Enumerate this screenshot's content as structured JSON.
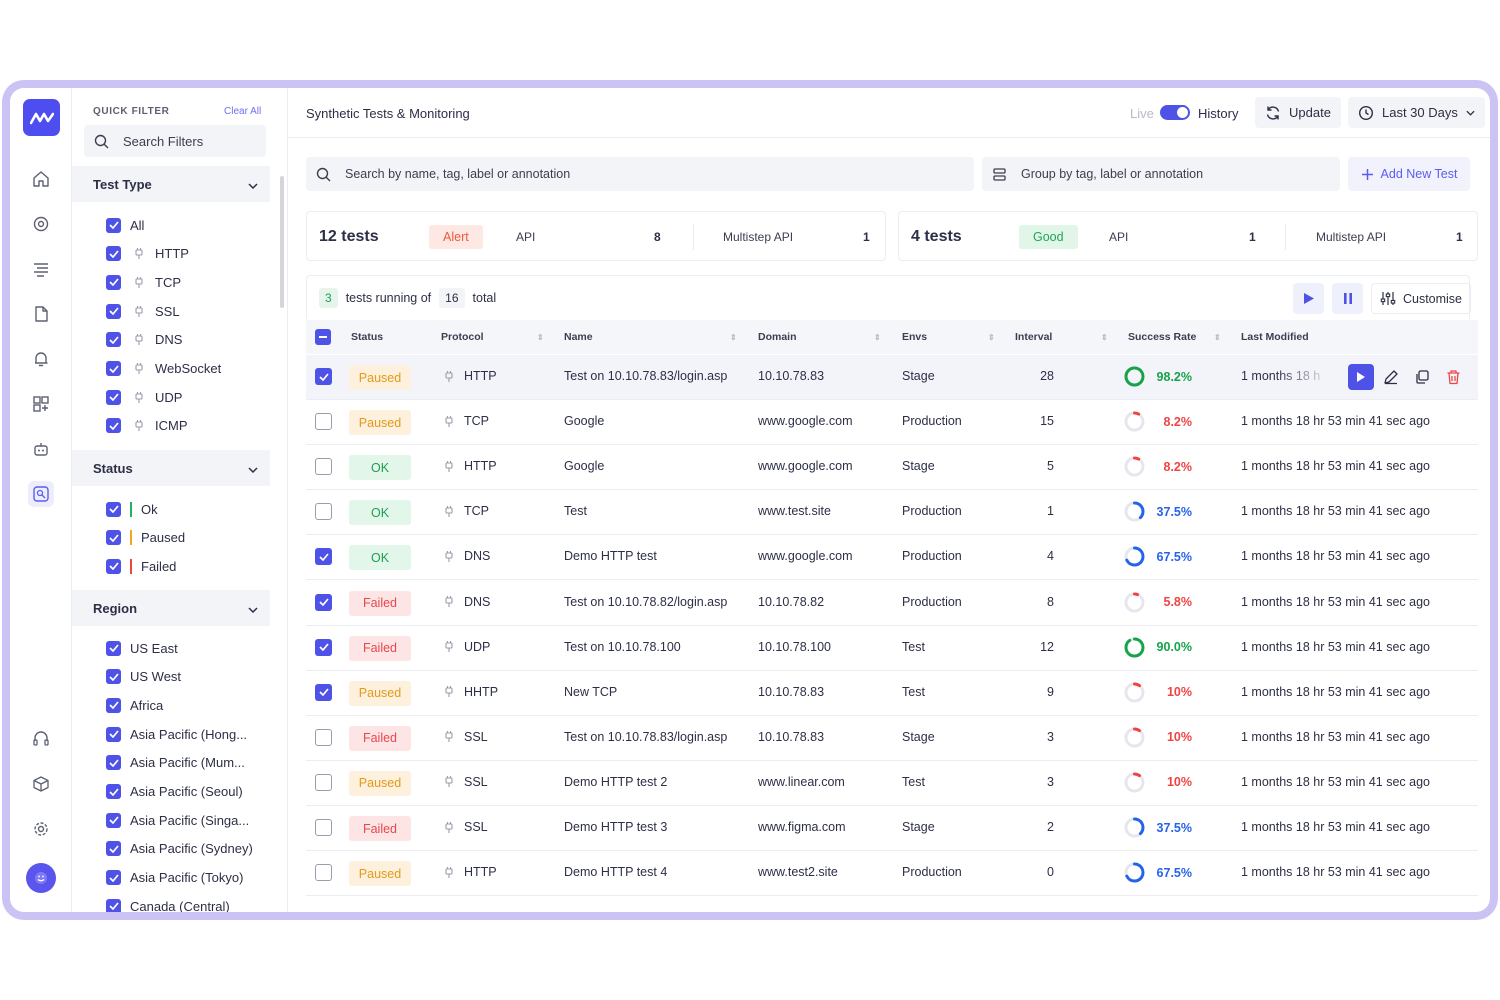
{
  "quick_filter": {
    "title": "QUICK FILTER",
    "clear_all": "Clear All",
    "search_placeholder": "Search Filters",
    "sections": {
      "test_type": {
        "title": "Test Type",
        "items": [
          {
            "label": "All",
            "icon": null
          },
          {
            "label": "HTTP",
            "icon": "plug-icon"
          },
          {
            "label": "TCP",
            "icon": "plug-icon"
          },
          {
            "label": "SSL",
            "icon": "plug-icon"
          },
          {
            "label": "DNS",
            "icon": "plug-icon"
          },
          {
            "label": "WebSocket",
            "icon": "plug-icon"
          },
          {
            "label": "UDP",
            "icon": "plug-icon"
          },
          {
            "label": "ICMP",
            "icon": "plug-icon"
          }
        ]
      },
      "status": {
        "title": "Status",
        "items": [
          {
            "label": "Ok",
            "color": "#22b35e"
          },
          {
            "label": "Paused",
            "color": "#f5a524"
          },
          {
            "label": "Failed",
            "color": "#ef4444"
          }
        ]
      },
      "region": {
        "title": "Region",
        "items": [
          "US East",
          "US West",
          "Africa",
          "Asia Pacific (Hong...",
          "Asia Pacific (Mum...",
          "Asia Pacific (Seoul)",
          "Asia Pacific (Singa...",
          "Asia Pacific (Sydney)",
          "Asia Pacific (Tokyo)",
          "Canada (Central)"
        ]
      }
    }
  },
  "topbar": {
    "title": "Synthetic Tests & Monitoring",
    "live_label": "Live",
    "history_label": "History",
    "update_label": "Update",
    "range_label": "Last 30 Days"
  },
  "toolbar": {
    "search_placeholder": "Search by name, tag, label or annotation",
    "group_placeholder": "Group by tag, label or annotation",
    "add_label": "Add New Test"
  },
  "summary": [
    {
      "count": "12 tests",
      "badge": "Alert",
      "api_label": "API",
      "api_count": "8",
      "multistep_label": "Multistep API",
      "multistep_count": "1"
    },
    {
      "count": "4 tests",
      "badge": "Good",
      "api_label": "API",
      "api_count": "1",
      "multistep_label": "Multistep API",
      "multistep_count": "1"
    }
  ],
  "running": {
    "running": "3",
    "text1": "tests running of",
    "total": "16",
    "text2": "total",
    "customise": "Customise"
  },
  "table": {
    "headers": [
      "Status",
      "Protocol",
      "Name",
      "Domain",
      "Envs",
      "Interval",
      "Success Rate",
      "Last Modified"
    ],
    "rows": [
      {
        "checked": true,
        "status": "Paused",
        "protocol": "HTTP",
        "name": "Test on 10.10.78.83/login.asp",
        "domain": "10.10.78.83",
        "env": "Stage",
        "interval": "28",
        "rate": "98.2%",
        "rate_value": 98.2,
        "modified": "1 months 18 h"
      },
      {
        "checked": false,
        "status": "Paused",
        "protocol": "TCP",
        "name": "Google",
        "domain": "www.google.com",
        "env": "Production",
        "interval": "15",
        "rate": "8.2%",
        "rate_value": 8.2,
        "modified": "1 months 18 hr 53 min 41 sec ago"
      },
      {
        "checked": false,
        "status": "OK",
        "protocol": "HTTP",
        "name": "Google",
        "domain": "www.google.com",
        "env": "Stage",
        "interval": "5",
        "rate": "8.2%",
        "rate_value": 8.2,
        "modified": "1 months 18 hr 53 min 41 sec ago"
      },
      {
        "checked": false,
        "status": "OK",
        "protocol": "TCP",
        "name": "Test",
        "domain": "www.test.site",
        "env": "Production",
        "interval": "1",
        "rate": "37.5%",
        "rate_value": 37.5,
        "modified": "1 months 18 hr 53 min 41 sec ago"
      },
      {
        "checked": true,
        "status": "OK",
        "protocol": "DNS",
        "name": "Demo HTTP test",
        "domain": "www.google.com",
        "env": "Production",
        "interval": "4",
        "rate": "67.5%",
        "rate_value": 67.5,
        "modified": "1 months 18 hr 53 min 41 sec ago"
      },
      {
        "checked": true,
        "status": "Failed",
        "protocol": "DNS",
        "name": "Test on 10.10.78.82/login.asp",
        "domain": "10.10.78.82",
        "env": "Production",
        "interval": "8",
        "rate": "5.8%",
        "rate_value": 5.8,
        "modified": "1 months 18 hr 53 min 41 sec ago"
      },
      {
        "checked": true,
        "status": "Failed",
        "protocol": "UDP",
        "name": "Test on 10.10.78.100",
        "domain": "10.10.78.100",
        "env": "Test",
        "interval": "12",
        "rate": "90.0%",
        "rate_value": 90.0,
        "modified": "1 months 18 hr 53 min 41 sec ago"
      },
      {
        "checked": true,
        "status": "Paused",
        "protocol": "HHTP",
        "name": "New TCP",
        "domain": "10.10.78.83",
        "env": "Test",
        "interval": "9",
        "rate": "10%",
        "rate_value": 10,
        "modified": "1 months 18 hr 53 min 41 sec ago"
      },
      {
        "checked": false,
        "status": "Failed",
        "protocol": "SSL",
        "name": "Test on 10.10.78.83/login.asp",
        "domain": "10.10.78.83",
        "env": "Stage",
        "interval": "3",
        "rate": "10%",
        "rate_value": 10,
        "modified": "1 months 18 hr 53 min 41 sec ago"
      },
      {
        "checked": false,
        "status": "Paused",
        "protocol": "SSL",
        "name": "Demo HTTP test 2",
        "domain": "www.linear.com",
        "env": "Test",
        "interval": "3",
        "rate": "10%",
        "rate_value": 10,
        "modified": "1 months 18 hr 53 min 41 sec ago"
      },
      {
        "checked": false,
        "status": "Failed",
        "protocol": "SSL",
        "name": "Demo HTTP test 3",
        "domain": "www.figma.com",
        "env": "Stage",
        "interval": "2",
        "rate": "37.5%",
        "rate_value": 37.5,
        "modified": "1 months 18 hr 53 min 41 sec ago"
      },
      {
        "checked": false,
        "status": "Paused",
        "protocol": "HTTP",
        "name": "Demo HTTP test 4",
        "domain": "www.test2.site",
        "env": "Production",
        "interval": "0",
        "rate": "67.5%",
        "rate_value": 67.5,
        "modified": "1 months 18 hr 53 min 41 sec ago"
      }
    ]
  },
  "colors": {
    "accent": "#4f52e6",
    "ok_bg": "#e3f6ea",
    "ok_text": "#1f9e54",
    "paused_bg": "#fdf0dc",
    "paused_text": "#e49a1b",
    "failed_bg": "#fde5e5",
    "failed_text": "#e5484d",
    "rate_high": "#16a34a",
    "rate_mid": "#2563eb",
    "rate_low": "#ef4444"
  }
}
